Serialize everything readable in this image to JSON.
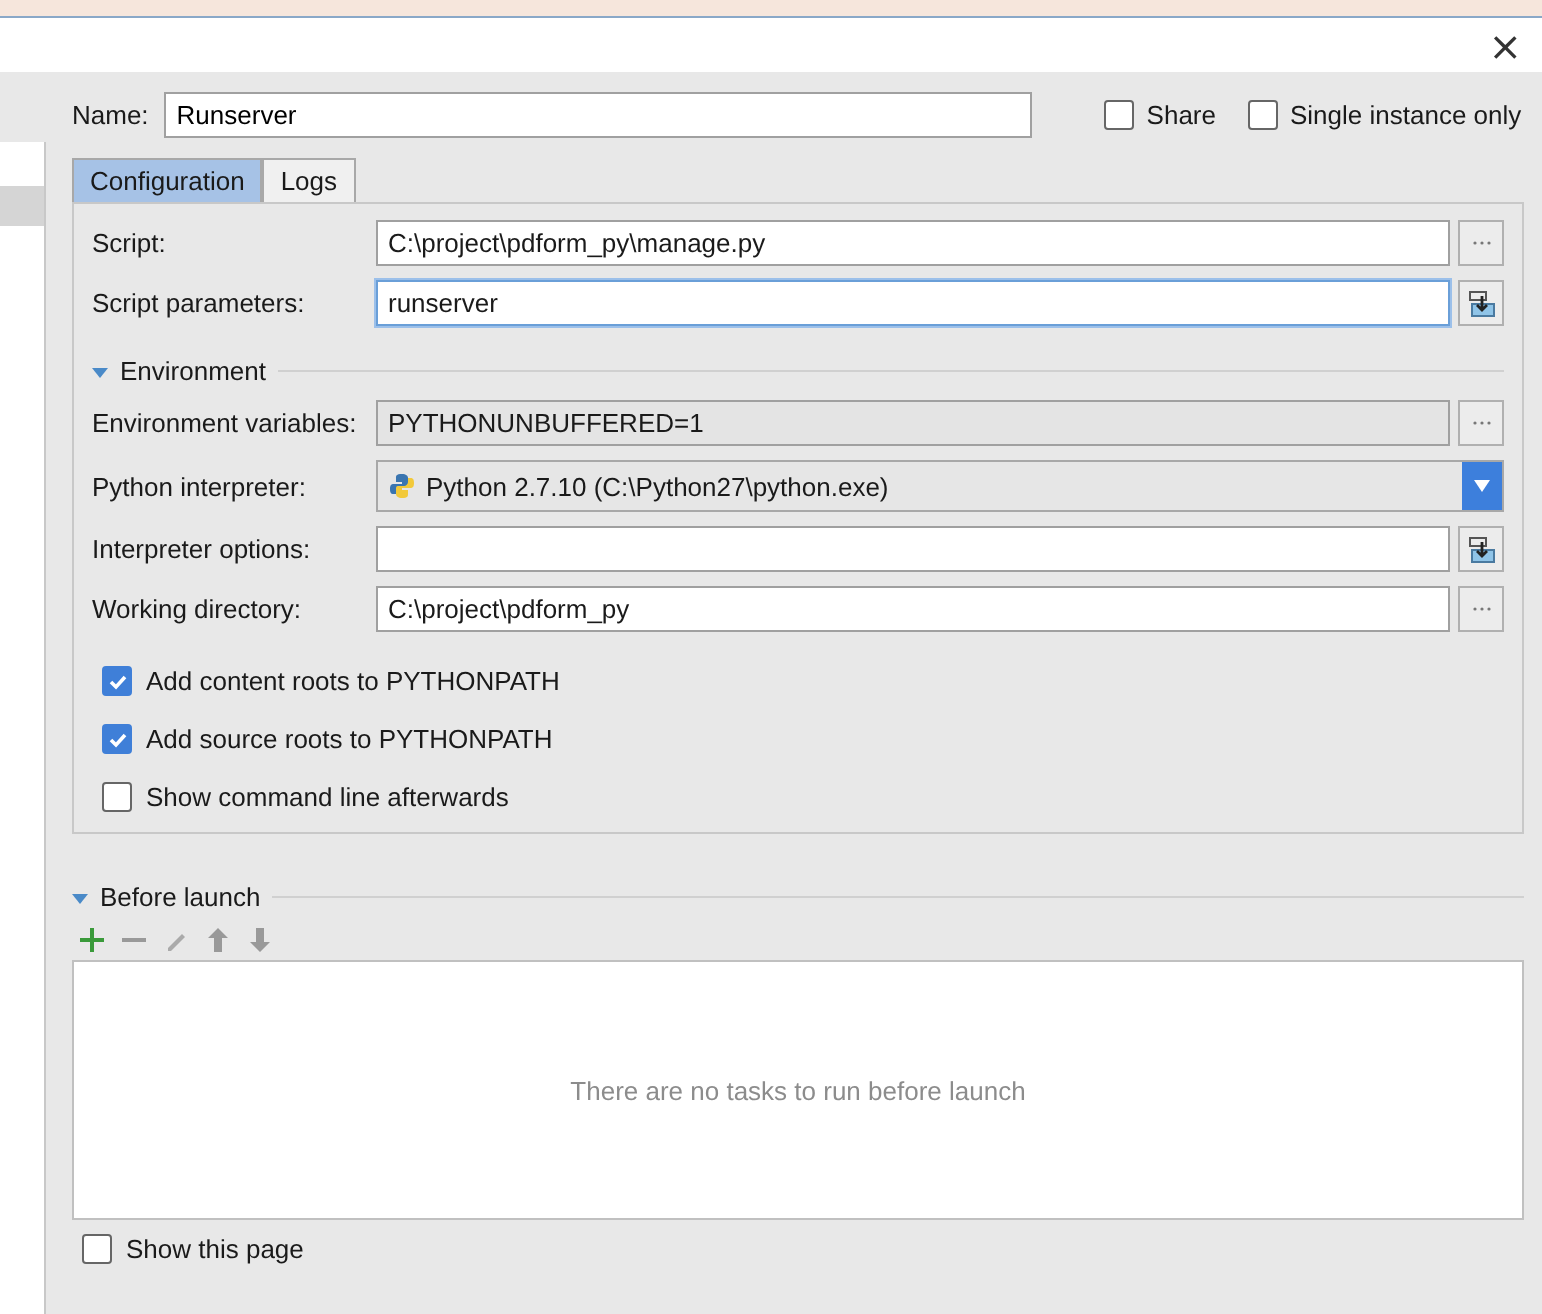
{
  "window": {
    "close": "×"
  },
  "sidebar": {
    "items": [
      {
        "selected": true
      }
    ]
  },
  "name": {
    "label": "Name:",
    "value": "Runserver"
  },
  "options": [
    {
      "label": "Share",
      "checked": false
    },
    {
      "label": "Single instance only",
      "checked": false
    }
  ],
  "tabs": [
    {
      "label": "Configuration",
      "selected": true
    },
    {
      "label": "Logs",
      "selected": false
    }
  ],
  "fields": [
    {
      "kind": "browse",
      "label": "Script:",
      "value": "C:\\project\\pdform_py\\manage.py",
      "focused": false,
      "readonly": false
    },
    {
      "kind": "insert",
      "label": "Script parameters:",
      "value": "runserver",
      "focused": true,
      "readonly": false
    },
    {
      "kind": "section",
      "label": "Environment",
      "expanded": true
    },
    {
      "kind": "browse",
      "label": "Environment variables:",
      "value": "PYTHONUNBUFFERED=1",
      "focused": false,
      "readonly": true
    },
    {
      "kind": "combo",
      "label": "Python interpreter:",
      "value": "Python 2.7.10 (C:\\Python27\\python.exe)"
    },
    {
      "kind": "insert",
      "label": "Interpreter options:",
      "focused": false,
      "readonly": false
    },
    {
      "kind": "browse",
      "label": "Working directory:",
      "value": "C:\\project\\pdform_py",
      "focused": false,
      "readonly": false
    }
  ],
  "checkboxes": [
    {
      "label": "Add content roots to PYTHONPATH",
      "checked": true
    },
    {
      "label": "Add source roots to PYTHONPATH",
      "checked": true
    },
    {
      "label": "Show command line afterwards",
      "checked": false
    }
  ],
  "before_launch": {
    "label": "Before launch",
    "expanded": true,
    "empty_text": "There are no tasks to run before launch"
  },
  "show_page": {
    "label": "Show this page",
    "checked": false
  }
}
